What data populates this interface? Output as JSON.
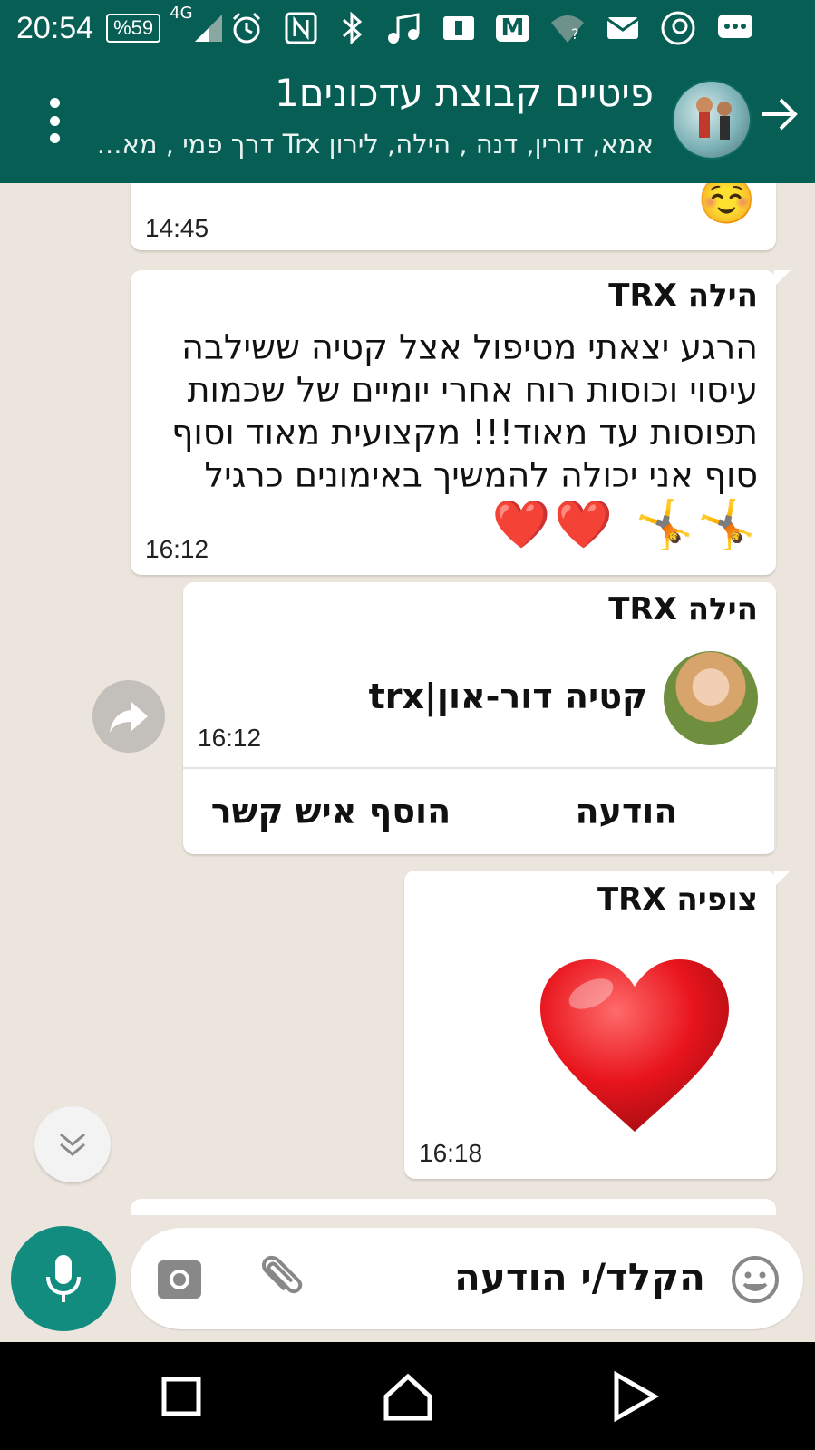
{
  "status_bar": {
    "time": "20:54",
    "battery": "%59",
    "network": "4G"
  },
  "header": {
    "title": "פיטיים קבוצת עדכונים1",
    "subtitle": "אמא, דורין, דנה , הילה, לירון Trx דרך פמי , מא..."
  },
  "messages": [
    {
      "time": "14:45",
      "emoji": "☺️"
    },
    {
      "sender": "הילה TRX",
      "text": "הרגע יצאתי מטיפול אצל קטיה ששילבה עיסוי וכוסות רוח אחרי יומיים של שכמות תפוסות עד מאוד!!! מקצועית מאוד וסוף סוף אני יכולה להמשיך באימונים כרגיל",
      "emojis": "🤸🤸 ❤️❤️",
      "time": "16:12"
    },
    {
      "sender": "הילה TRX",
      "contact_name": "קטיה דור-און|trx",
      "time": "16:12",
      "action_message": "הודעה",
      "action_add_contact": "הוסף איש קשר"
    },
    {
      "sender": "צופיה TRX",
      "time": "16:18"
    }
  ],
  "input": {
    "placeholder": "הקלד/י הודעה"
  },
  "colors": {
    "header": "#075e54",
    "accent": "#128c7e",
    "chat_bg": "#ece5dd"
  },
  "icons": [
    "back-arrow-icon",
    "menu-icon",
    "forward-icon",
    "scroll-down-icon",
    "mic-icon",
    "camera-icon",
    "attach-icon",
    "emoji-icon",
    "nav-back-icon",
    "nav-home-icon",
    "nav-recents-icon"
  ]
}
